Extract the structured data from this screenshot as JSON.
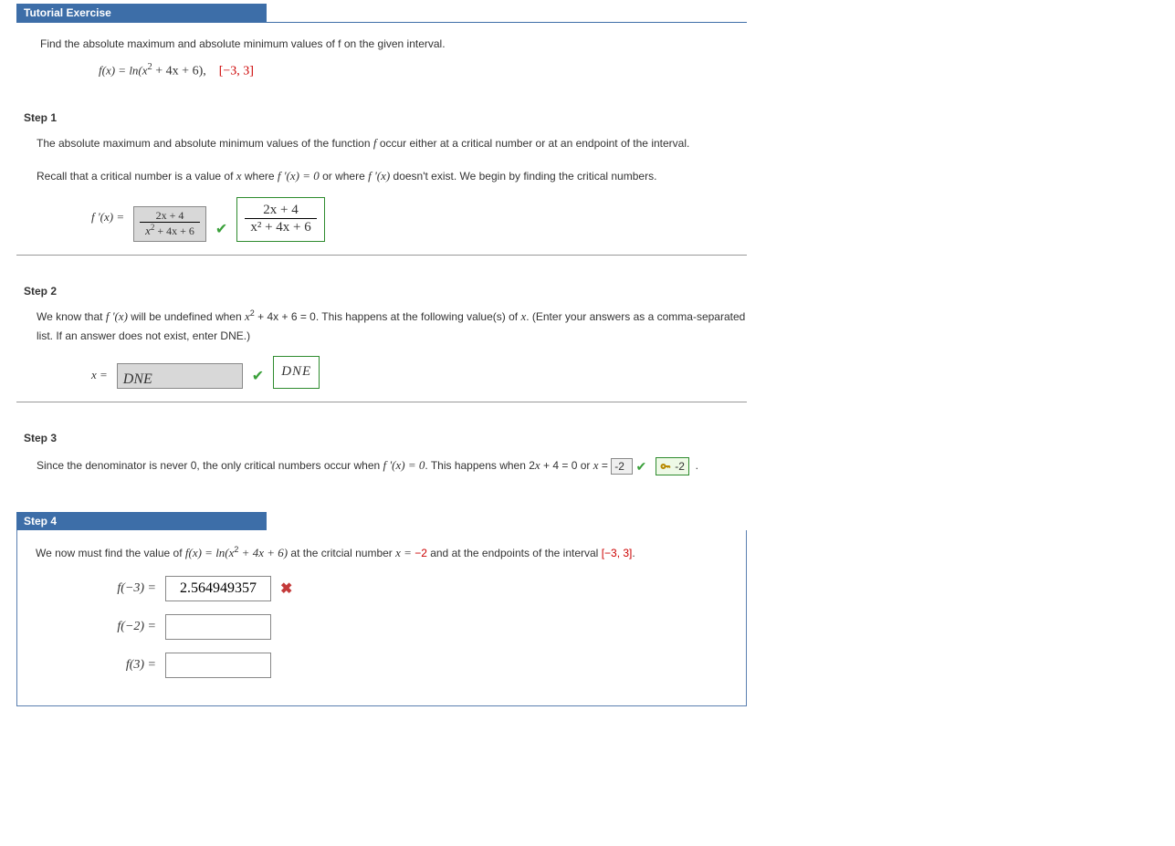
{
  "header": {
    "title": "Tutorial Exercise"
  },
  "prompt": {
    "text": "Find the absolute maximum and absolute minimum values of f on the given interval.",
    "fx_label": "f(x) = ln(x",
    "fx_tail": " + 4x + 6),",
    "interval": "[−3, 3]"
  },
  "step1": {
    "heading": "Step 1",
    "p1a": "The absolute maximum and absolute minimum values of the function ",
    "p1b": " occur either at a critical number or at an endpoint of the interval.",
    "p2a": "Recall that a critical number is a value of ",
    "p2x": "x",
    "p2b": " where  ",
    "fprime1": "f '(x) = 0",
    "p2c": "  or where  ",
    "fprime2": "f '(x)",
    "p2d": "  doesn't exist. We begin by finding the critical numbers.",
    "lhs": "f '(x) =",
    "num1": "2x + 4",
    "den1_a": "x",
    "den1_b": " + 4x + 6",
    "num2": "2x + 4",
    "den2": "x² + 4x + 6"
  },
  "step2": {
    "heading": "Step 2",
    "p1a": "We know that ",
    "fprime": "f '(x)",
    "p1b": " will be undefined when  ",
    "eq_a": "x",
    "eq_b": " + 4x + 6 = 0.",
    "p1c": "  This happens at the following value(s) of ",
    "p1x": "x",
    "p1d": ". (Enter your answers as a comma-separated list. If an answer does not exist, enter DNE.)",
    "xeq": "x =",
    "entry": "DNE",
    "confirm": "DNE"
  },
  "step3": {
    "heading": "Step 3",
    "p1a": "Since the denominator is never 0, the only critical numbers occur when ",
    "fprime": "f '(x) = 0",
    "p1b": ". This happens when 2",
    "p1x": "x",
    "p1c": " + 4 = 0 or ",
    "xeq": "x",
    "eq": " = ",
    "entry": "-2",
    "confirm": "-2",
    "dot": "."
  },
  "step4": {
    "heading": "Step 4",
    "p1a": "We now must find the value of ",
    "fx1": "f(x) = ln(x",
    "fx2": " + 4x + 6)",
    "p1b": " at the critcial number  ",
    "xeq": "x = ",
    "xval": "−2",
    "p1c": "  and at the endpoints of the interval  ",
    "interval": "[−3, 3]",
    "p1d": ".",
    "rows": [
      {
        "label": "f(−3)  =",
        "value": "2.564949357",
        "mark": "cross"
      },
      {
        "label": "f(−2)  =",
        "value": "",
        "mark": ""
      },
      {
        "label": "f(3)  =",
        "value": "",
        "mark": ""
      }
    ]
  }
}
